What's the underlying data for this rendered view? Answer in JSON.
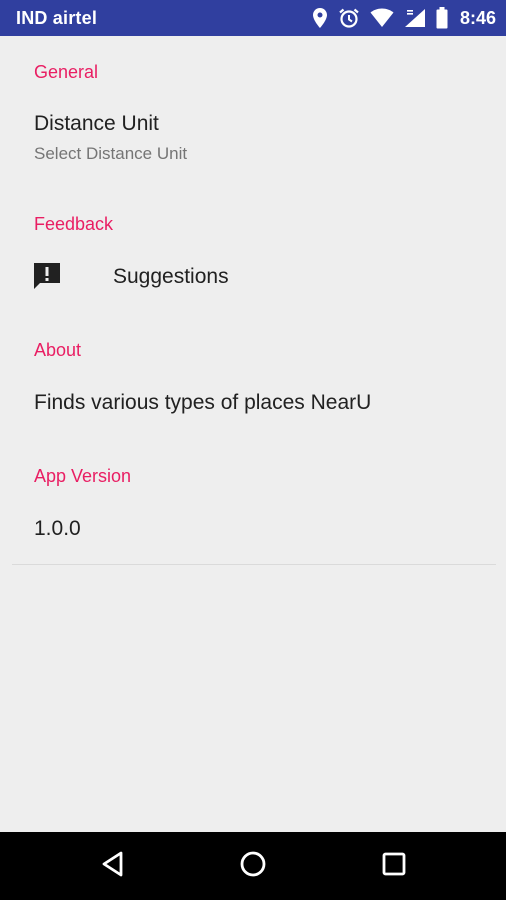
{
  "status_bar": {
    "carrier": "IND airtel",
    "time": "8:46",
    "icons": [
      "location-icon",
      "alarm-icon",
      "wifi-icon",
      "cell-signal-icon",
      "battery-icon"
    ]
  },
  "settings": {
    "general": {
      "header": "General",
      "distance_unit": {
        "title": "Distance Unit",
        "summary": "Select Distance Unit"
      }
    },
    "feedback": {
      "header": "Feedback",
      "suggestions": {
        "label": "Suggestions",
        "icon": "feedback-icon"
      }
    },
    "about": {
      "header": "About",
      "description": "Finds various types of places NearU"
    },
    "app_version": {
      "header": "App Version",
      "value": "1.0.0"
    }
  },
  "nav_bar": {
    "buttons": [
      "back-icon",
      "home-icon",
      "recents-icon"
    ]
  },
  "colors": {
    "status_bar": "#303F9F",
    "accent": "#E91E63",
    "background": "#EEEEEE",
    "nav_bar": "#000000"
  }
}
